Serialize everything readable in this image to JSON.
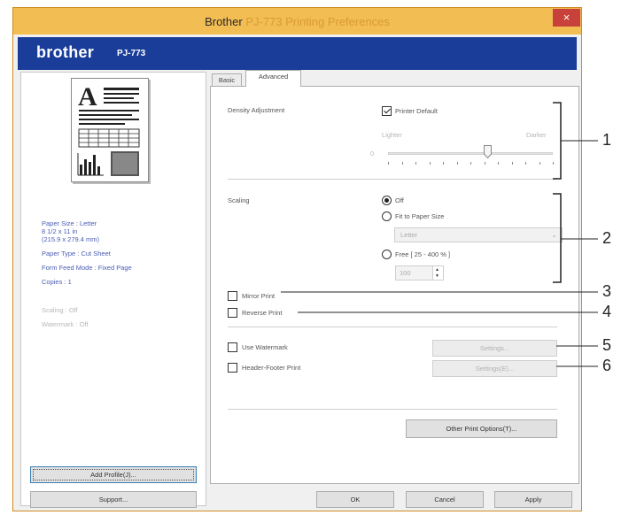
{
  "window": {
    "title_prefix": "Brother",
    "title_product": "PJ-773 Printing Preferences",
    "close_glyph": "×"
  },
  "banner": {
    "logo": "brother",
    "model": "PJ-773",
    "color": "#1a3d9a"
  },
  "left_panel": {
    "paper_info": [
      "Paper Size : Letter",
      "8 1/2 x 11 in",
      "(215.9 x 279.4 mm)",
      "Paper Type : Cut Sheet",
      "Form Feed Mode : Fixed Page",
      "Copies : 1"
    ],
    "other_info": [
      "Scaling : Off",
      "Watermark : Off"
    ],
    "add_profile_button": "Add Profile(J)...",
    "support_button": "Support..."
  },
  "tabs": [
    {
      "label": "Basic",
      "active": false
    },
    {
      "label": "Advanced",
      "active": true
    }
  ],
  "density": {
    "label": "Density Adjustment",
    "printer_default_label": "Printer Default",
    "printer_default_checked": true,
    "lighter_label": "Lighter",
    "darker_label": "Darker",
    "scale_start": "0",
    "level_fraction": 0.6
  },
  "scaling": {
    "label": "Scaling",
    "options": [
      "Off",
      "Fit to Paper Size",
      "Free [ 25 - 400 % ]"
    ],
    "selected": "Off",
    "paper_select_value": "Letter",
    "free_value": "100"
  },
  "checkboxes": {
    "mirror_print": "Mirror Print",
    "reverse_print": "Reverse Print",
    "use_watermark": "Use Watermark",
    "header_footer_print": "Header-Footer Print"
  },
  "buttons": {
    "watermark_settings": "Settings...",
    "header_footer_settings": "Settings(E)...",
    "other_print_options": "Other Print Options(T)...",
    "ok": "OK",
    "cancel": "Cancel",
    "apply": "Apply"
  },
  "callouts": [
    "1",
    "2",
    "3",
    "4",
    "5",
    "6"
  ]
}
